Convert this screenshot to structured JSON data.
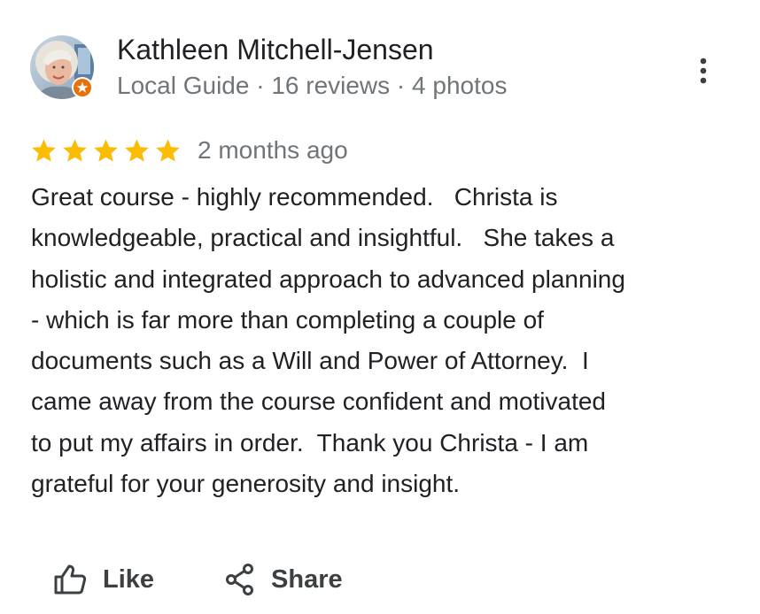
{
  "reviewer": {
    "name": "Kathleen Mitchell-Jensen",
    "meta": "Local Guide · 16 reviews · 4 photos"
  },
  "review": {
    "rating": 5,
    "rating_max": 5,
    "date": "2 months ago",
    "text": "Great course - highly recommended.   Christa is\nknowledgeable, practical and insightful.   She takes a\nholistic and integrated approach to advanced planning\n- which is far more than completing a couple of\ndocuments such as a Will and Power of Attorney.  I\ncame away from the course confident and motivated\nto put my affairs in order.  Thank you Christa - I am\ngrateful for your generosity and insight."
  },
  "actions": {
    "like_label": "Like",
    "share_label": "Share"
  },
  "icons": {
    "avatar": "avatar-photo",
    "badge": "local-guide-badge-icon",
    "menu": "more-vert-icon",
    "star": "star-icon",
    "like": "thumb-up-icon",
    "share": "share-icon"
  },
  "colors": {
    "star": "#fbbc04",
    "badge": "#e8710a",
    "text": "#202124",
    "secondary_text": "#70757a",
    "action_text": "#3c4043"
  }
}
